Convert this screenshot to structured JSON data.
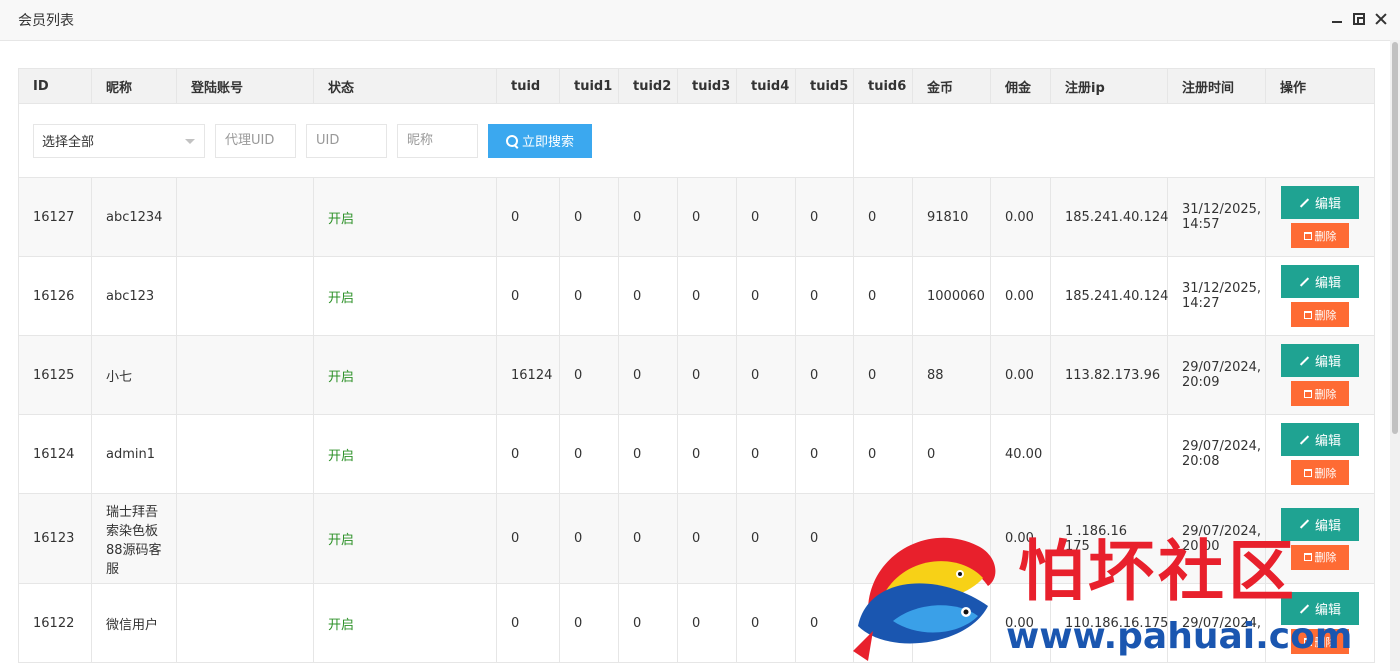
{
  "window": {
    "title": "会员列表"
  },
  "table": {
    "headers": [
      "ID",
      "昵称",
      "登陆账号",
      "状态",
      "tuid",
      "tuid1",
      "tuid2",
      "tuid3",
      "tuid4",
      "tuid5",
      "tuid6",
      "金币",
      "佣金",
      "注册ip",
      "注册时间",
      "操作"
    ],
    "rows": [
      {
        "id": "16127",
        "nickname": "abc1234",
        "account": "",
        "status": "开启",
        "tuid": "0",
        "tuid1": "0",
        "tuid2": "0",
        "tuid3": "0",
        "tuid4": "0",
        "tuid5": "0",
        "tuid6": "0",
        "coins": "91810",
        "commission": "0.00",
        "ip": "185.241.40.124",
        "time": "31/12/2025, 14:57"
      },
      {
        "id": "16126",
        "nickname": "abc123",
        "account": "",
        "status": "开启",
        "tuid": "0",
        "tuid1": "0",
        "tuid2": "0",
        "tuid3": "0",
        "tuid4": "0",
        "tuid5": "0",
        "tuid6": "0",
        "coins": "1000060",
        "commission": "0.00",
        "ip": "185.241.40.124",
        "time": "31/12/2025, 14:27"
      },
      {
        "id": "16125",
        "nickname": "小七",
        "account": "",
        "status": "开启",
        "tuid": "16124",
        "tuid1": "0",
        "tuid2": "0",
        "tuid3": "0",
        "tuid4": "0",
        "tuid5": "0",
        "tuid6": "0",
        "coins": "88",
        "commission": "0.00",
        "ip": "113.82.173.96",
        "time": "29/07/2024, 20:09"
      },
      {
        "id": "16124",
        "nickname": "admin1",
        "account": "",
        "status": "开启",
        "tuid": "0",
        "tuid1": "0",
        "tuid2": "0",
        "tuid3": "0",
        "tuid4": "0",
        "tuid5": "0",
        "tuid6": "0",
        "coins": "0",
        "commission": "40.00",
        "ip": "",
        "time": "29/07/2024, 20:08"
      },
      {
        "id": "16123",
        "nickname": "瑞士拜吾索染色板88源码客服",
        "account": "",
        "status": "开启",
        "tuid": "0",
        "tuid1": "0",
        "tuid2": "0",
        "tuid3": "0",
        "tuid4": "0",
        "tuid5": "0",
        "tuid6": "",
        "coins": "",
        "commission": "0.00",
        "ip": "1 .186.16 175",
        "time": "29/07/2024, 20:00"
      },
      {
        "id": "16122",
        "nickname": "微信用户",
        "account": "",
        "status": "开启",
        "tuid": "0",
        "tuid1": "0",
        "tuid2": "0",
        "tuid3": "0",
        "tuid4": "0",
        "tuid5": "0",
        "tuid6": "",
        "coins": "",
        "commission": "0.00",
        "ip": "110.186.16.175",
        "time": "29/07/2024,"
      }
    ],
    "actions": {
      "edit": "编辑",
      "delete": "删除"
    }
  },
  "search": {
    "select_value": "选择全部",
    "agent_uid_placeholder": "代理UID",
    "uid_placeholder": "UID",
    "nickname_placeholder": "昵称",
    "button": "立即搜索"
  },
  "watermark": {
    "title": "怕坏社区",
    "url": "www.pahuai.com"
  },
  "colors": {
    "accent": "#1fa392",
    "danger": "#fe6b34",
    "primary": "#3ba8ef",
    "status_on": "#2d9128"
  }
}
